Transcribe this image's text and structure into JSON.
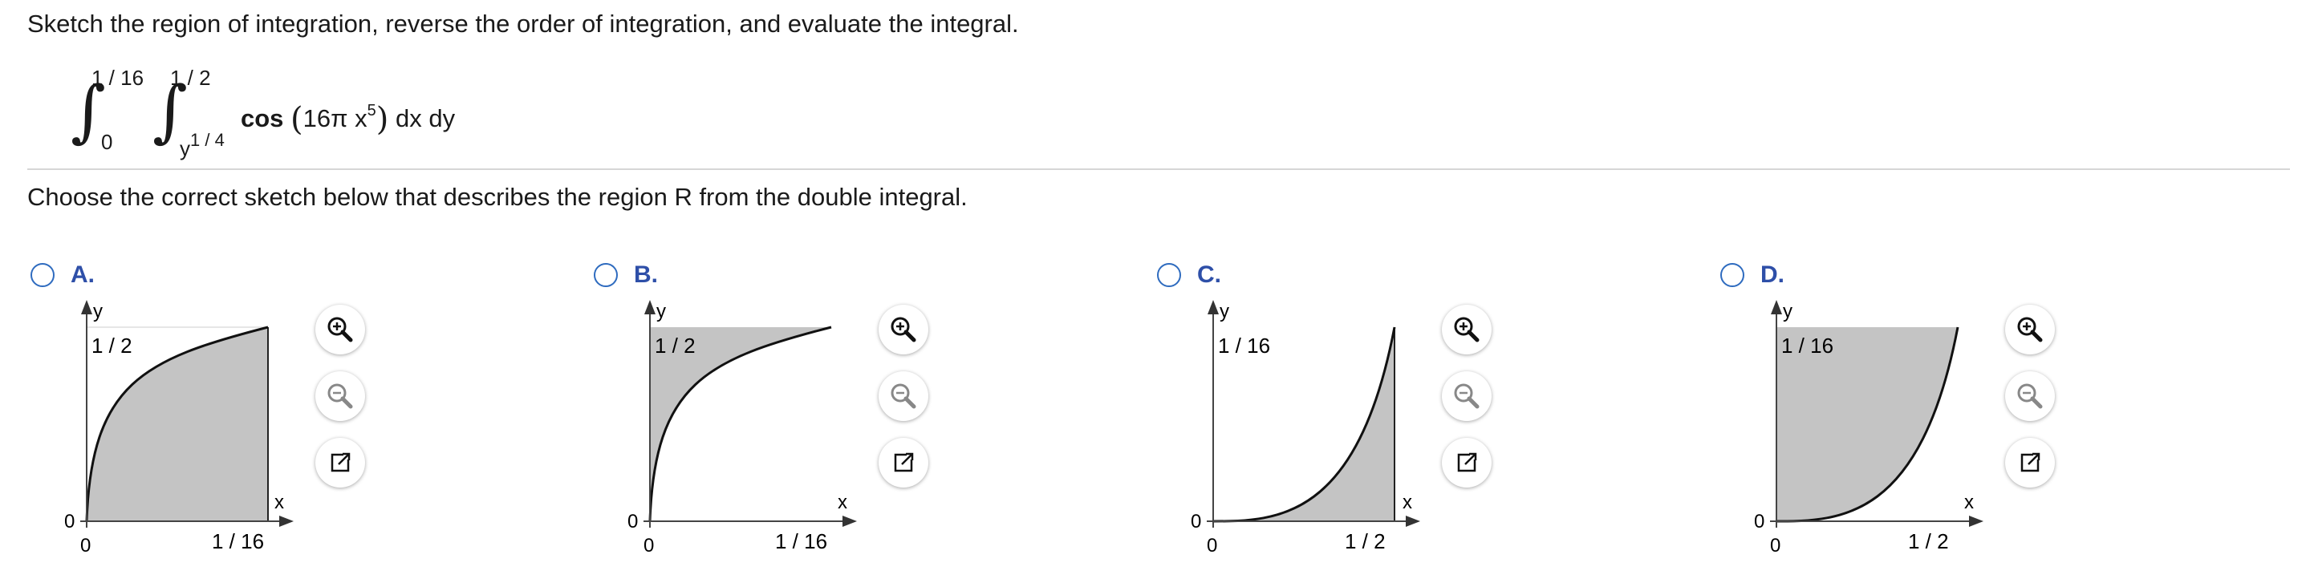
{
  "question": {
    "prompt": "Sketch the region of integration, reverse the order of integration, and evaluate the integral.",
    "integral": {
      "outer_upper": "1 / 16",
      "outer_lower": "0",
      "inner_upper": "1 / 2",
      "inner_lower_base": "y",
      "inner_lower_exp": "1 / 4",
      "func": "cos",
      "arg_pre": "16π x",
      "arg_exp": "5",
      "tail": "dx dy"
    },
    "subprompt": "Choose the correct sketch below that describes the region R from the double integral."
  },
  "options": [
    {
      "letter": "A.",
      "axis_y": "y",
      "axis_x": "x",
      "y_tick": "1 / 2",
      "x_tick": "1 / 16",
      "origin_y": "0",
      "origin_x": "0"
    },
    {
      "letter": "B.",
      "axis_y": "y",
      "axis_x": "x",
      "y_tick": "1 / 2",
      "x_tick": "1 / 16",
      "origin_y": "0",
      "origin_x": "0"
    },
    {
      "letter": "C.",
      "axis_y": "y",
      "axis_x": "x",
      "y_tick": "1 / 16",
      "x_tick": "1 / 2",
      "origin_y": "0",
      "origin_x": "0"
    },
    {
      "letter": "D.",
      "axis_y": "y",
      "axis_x": "x",
      "y_tick": "1 / 16",
      "x_tick": "1 / 2",
      "origin_y": "0",
      "origin_x": "0"
    }
  ],
  "icons": {
    "zoom_in": "zoom-in-icon",
    "zoom_out": "zoom-out-icon",
    "popout": "popout-icon"
  },
  "colors": {
    "accent": "#2e4fa8",
    "radio": "#2e6bbf",
    "fill": "#c4c4c4"
  }
}
